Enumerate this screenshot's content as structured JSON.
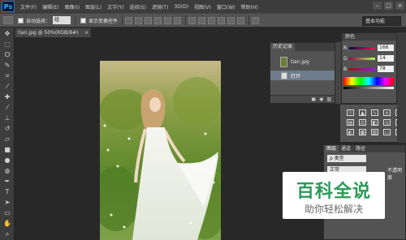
{
  "app": {
    "logo": "Ps"
  },
  "menu": [
    "文件(F)",
    "编辑(E)",
    "图像(I)",
    "图层(L)",
    "文字(Y)",
    "选择(S)",
    "滤镜(T)",
    "3D(D)",
    "视图(V)",
    "窗口(W)",
    "帮助(H)"
  ],
  "window_controls": [
    "–",
    "□",
    "×"
  ],
  "options": {
    "auto_select_label": "自动选择：",
    "auto_select_value": "组",
    "show_transform_label": "显示变换控件",
    "workspace": "基本功能"
  },
  "document": {
    "tab_title": "tian.jpg @ 50%(RGB/8#)",
    "tab_close": "×"
  },
  "history": {
    "title": "历史记录",
    "snapshot": "tian.jpg",
    "step": "打开"
  },
  "color": {
    "title": "颜色",
    "r_label": "R",
    "r": "166",
    "g_label": "G",
    "g": "14",
    "b_label": "B",
    "b": "78",
    "foreground": "#a60e4e"
  },
  "layers": {
    "tabs": [
      "图层",
      "通道",
      "路径"
    ],
    "kind": "ρ 类型",
    "blend": "正常",
    "opacity_label": "不透明度"
  },
  "watermark": {
    "title": "百科全说",
    "subtitle": "助你轻松解决"
  }
}
